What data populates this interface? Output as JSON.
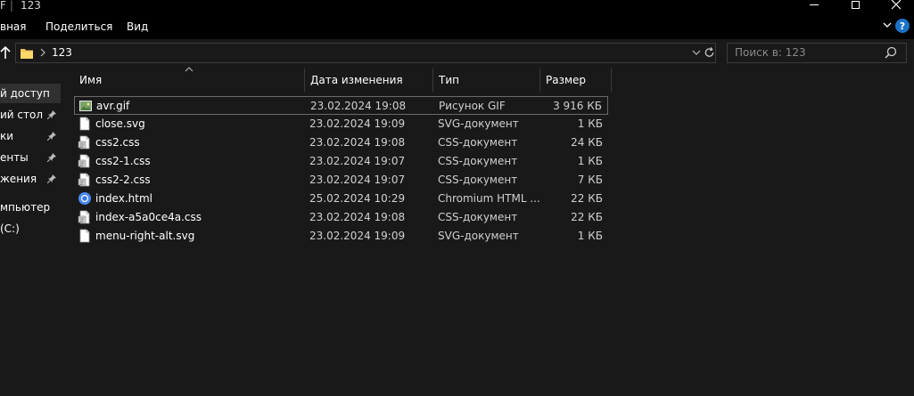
{
  "window": {
    "title_prefix": "F",
    "title": "123"
  },
  "ribbon": {
    "tabs": [
      "вная",
      "Поделиться",
      "Вид"
    ]
  },
  "address": {
    "path": "123",
    "search_placeholder": "Поиск в: 123"
  },
  "sidebar": {
    "items": [
      {
        "label": "й доступ",
        "pinned": false,
        "active": true
      },
      {
        "label": "ий стол",
        "pinned": true
      },
      {
        "label": "ки",
        "pinned": true
      },
      {
        "label": "енты",
        "pinned": true
      },
      {
        "label": "жения",
        "pinned": true
      },
      {
        "label": "мпьютер",
        "pinned": false
      },
      {
        "label": " (C:)",
        "pinned": false
      }
    ]
  },
  "columns": {
    "name": "Имя",
    "date": "Дата изменения",
    "type": "Тип",
    "size": "Размер"
  },
  "files": [
    {
      "name": "avr.gif",
      "date": "23.02.2024 19:08",
      "type": "Рисунок GIF",
      "size": "3 916 КБ",
      "icon": "gif-image-icon",
      "selected": true
    },
    {
      "name": "close.svg",
      "date": "23.02.2024 19:09",
      "type": "SVG-документ",
      "size": "1 КБ",
      "icon": "blank-file-icon"
    },
    {
      "name": "css2.css",
      "date": "23.02.2024 19:08",
      "type": "CSS-документ",
      "size": "24 КБ",
      "icon": "css-file-icon"
    },
    {
      "name": "css2-1.css",
      "date": "23.02.2024 19:07",
      "type": "CSS-документ",
      "size": "1 КБ",
      "icon": "css-file-icon"
    },
    {
      "name": "css2-2.css",
      "date": "23.02.2024 19:07",
      "type": "CSS-документ",
      "size": "7 КБ",
      "icon": "css-file-icon"
    },
    {
      "name": "index.html",
      "date": "25.02.2024 10:29",
      "type": "Chromium HTML ...",
      "size": "22 КБ",
      "icon": "chromium-icon"
    },
    {
      "name": "index-a5a0ce4a.css",
      "date": "23.02.2024 19:08",
      "type": "CSS-документ",
      "size": "22 КБ",
      "icon": "css-file-icon"
    },
    {
      "name": "menu-right-alt.svg",
      "date": "23.02.2024 19:09",
      "type": "SVG-документ",
      "size": "1 КБ",
      "icon": "blank-file-icon"
    }
  ]
}
